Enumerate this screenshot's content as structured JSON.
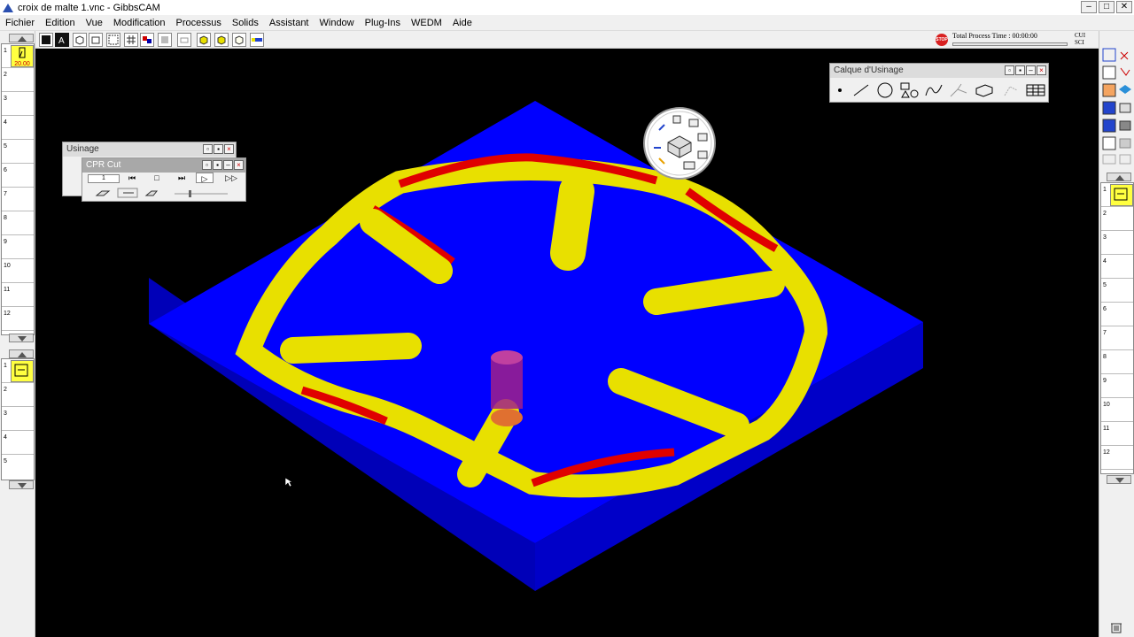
{
  "window": {
    "title": "croix de malte 1.vnc - GibbsCAM",
    "minimize": "–",
    "maximize": "□",
    "close": "✕"
  },
  "menu": [
    "Fichier",
    "Edition",
    "Vue",
    "Modification",
    "Processus",
    "Solids",
    "Assistant",
    "Window",
    "Plug-Ins",
    "WEDM",
    "Aide"
  ],
  "status": {
    "process_time": "Total Process Time : 00:00:00",
    "unit_top": "CUI",
    "unit_bottom": "SCI"
  },
  "left_palette": {
    "tool_label": "20.00",
    "top_list_numbers": [
      "1",
      "2",
      "3",
      "4",
      "5",
      "6",
      "7",
      "8",
      "9",
      "10",
      "11",
      "12"
    ],
    "bottom_list_numbers": [
      "1",
      "2",
      "3",
      "4",
      "5"
    ]
  },
  "right_palette": {
    "list_numbers": [
      "1",
      "2",
      "3",
      "4",
      "5",
      "6",
      "7",
      "8",
      "9",
      "10",
      "11",
      "12"
    ]
  },
  "usinage_panel": {
    "title": "Usinage"
  },
  "cpr_panel": {
    "title": "CPR Cut",
    "counter": "1"
  },
  "calque_panel": {
    "title": "Calque d'Usinage"
  },
  "colors": {
    "background": "#000000",
    "stock": "#0000ff",
    "stock_side": "#0000b8",
    "toolpath": "#e8e000",
    "wall": "#e00000",
    "tool": "#a0208a"
  },
  "icons": [
    "pen-icon",
    "point-icon",
    "line-icon",
    "circle-icon",
    "shape-icon",
    "spline-icon",
    "block-icon",
    "table-icon"
  ]
}
